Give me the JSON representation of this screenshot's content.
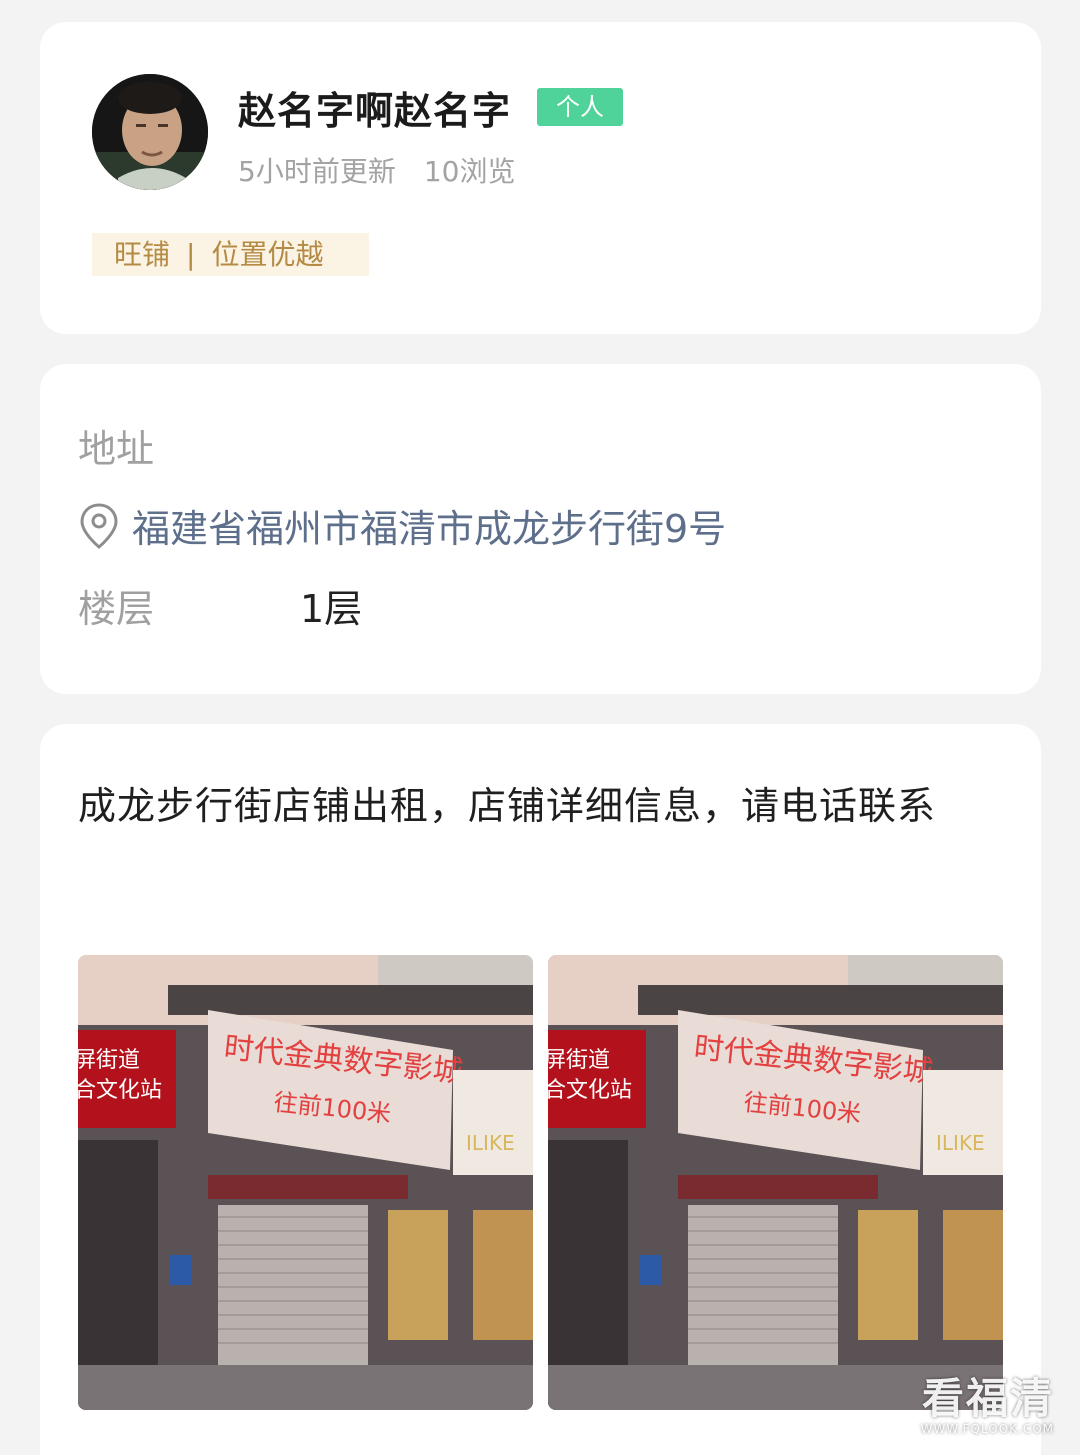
{
  "poster": {
    "name": "赵名字啊赵名字",
    "badge": "个人",
    "updated": "5小时前更新",
    "views": "10浏览",
    "tags": [
      "旺铺",
      "位置优越"
    ],
    "tag_separator": "|"
  },
  "address": {
    "label": "地址",
    "value": "福建省福州市福清市成龙步行街9号",
    "floor_label": "楼层",
    "floor_value": "1层"
  },
  "description": {
    "text": "成龙步行街店铺出租，店铺详细信息，请电话联系"
  },
  "photos": [
    {
      "signs": [
        "时代金典数字影城",
        "往前100米",
        "屏街道",
        "合文化站",
        "ILIKE"
      ]
    },
    {
      "signs": [
        "时代金典数字影城",
        "往前100米",
        "屏街道",
        "合文化站",
        "ILIKE"
      ]
    }
  ],
  "watermark": {
    "main": "看福清",
    "sub": "WWW.FQLOOK.COM"
  },
  "colors": {
    "badge": "#4fd39a",
    "tag_bg": "#fbf4e4",
    "tag_text": "#b48a44",
    "address_text": "#5e6f8b",
    "page_bg": "#f3f3f3"
  },
  "icons": {
    "location": "location-pin-icon"
  }
}
